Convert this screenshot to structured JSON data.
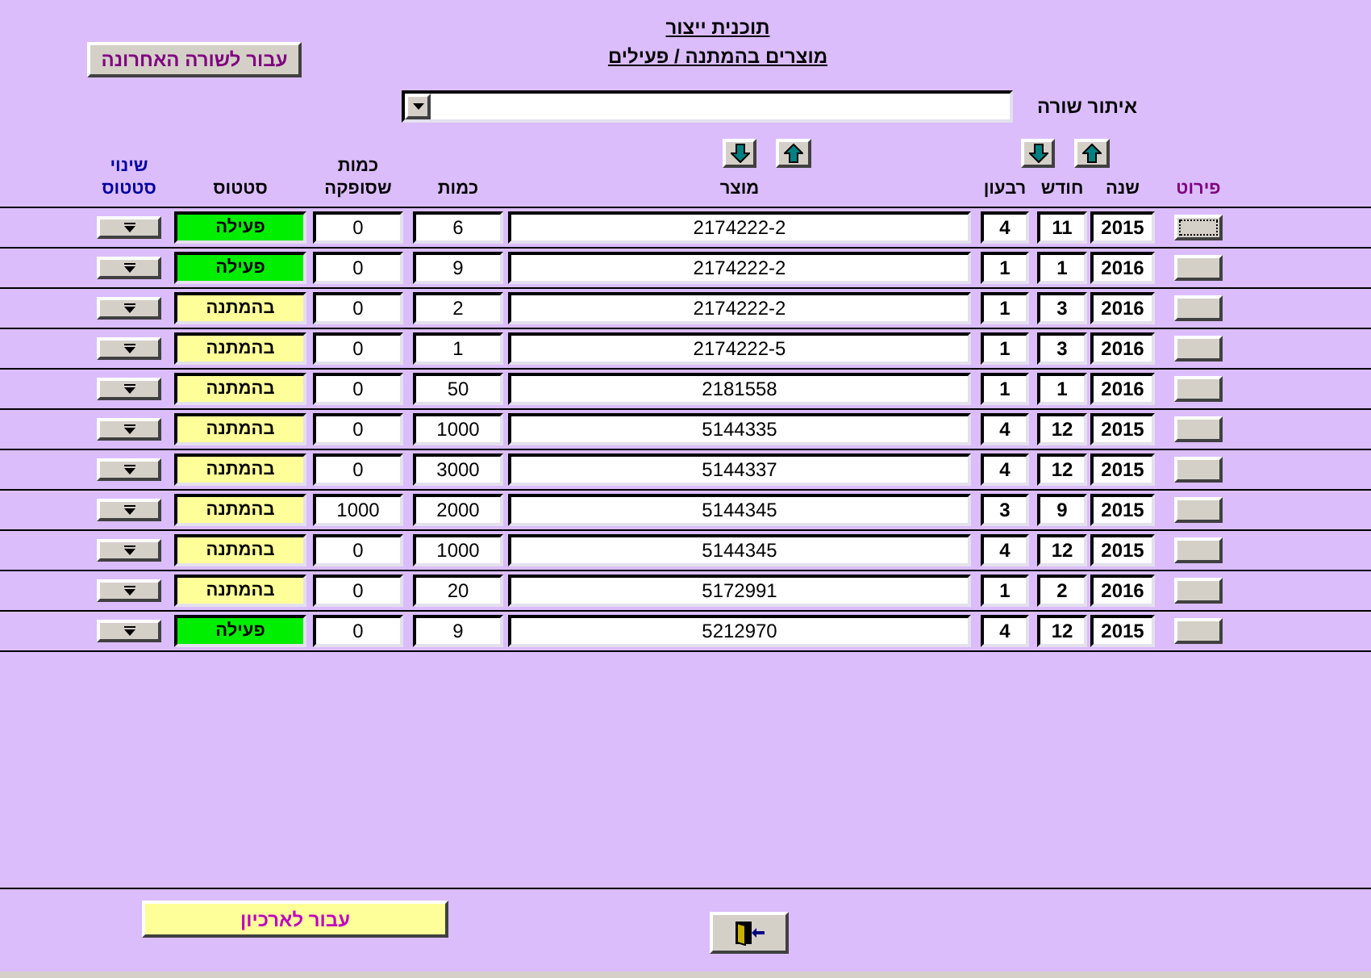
{
  "header": {
    "title": "תוכנית ייצור",
    "subtitle": "מוצרים בהמתנה / פעילים"
  },
  "go_to_last_button": {
    "label": "עבור לשורה האחרונה"
  },
  "find_row": {
    "label": "איתור שורה"
  },
  "table": {
    "columns": [
      {
        "label": "פירוט",
        "color": "#800080"
      },
      {
        "label": "שנה",
        "color": "#000000"
      },
      {
        "label": "חודש",
        "color": "#000000"
      },
      {
        "label": "רבעון",
        "color": "#000000"
      },
      {
        "label": "מוצר",
        "color": "#000000"
      },
      {
        "label": "כמות",
        "color": "#000000"
      },
      {
        "label": "כמות שסופקה",
        "color": "#000000"
      },
      {
        "label": "סטטוס",
        "color": "#000000"
      },
      {
        "label": "שינוי סטטוס",
        "color": "#0000a0"
      }
    ],
    "rows": [
      {
        "year": "2015",
        "month": "11",
        "quarter": "4",
        "product": "2174222-2",
        "quantity": "6",
        "supplied": "0",
        "status": "פעילה",
        "color": "#00ee00",
        "details_focused": true
      },
      {
        "year": "2016",
        "month": "1",
        "quarter": "1",
        "product": "2174222-2",
        "quantity": "9",
        "supplied": "0",
        "status": "פעילה",
        "color": "#00ee00",
        "details_focused": false
      },
      {
        "year": "2016",
        "month": "3",
        "quarter": "1",
        "product": "2174222-2",
        "quantity": "2",
        "supplied": "0",
        "status": "בהמתנה",
        "color": "#ffff99",
        "details_focused": false
      },
      {
        "year": "2016",
        "month": "3",
        "quarter": "1",
        "product": "2174222-5",
        "quantity": "1",
        "supplied": "0",
        "status": "בהמתנה",
        "color": "#ffff99",
        "details_focused": false
      },
      {
        "year": "2016",
        "month": "1",
        "quarter": "1",
        "product": "2181558",
        "quantity": "50",
        "supplied": "0",
        "status": "בהמתנה",
        "color": "#ffff99",
        "details_focused": false
      },
      {
        "year": "2015",
        "month": "12",
        "quarter": "4",
        "product": "5144335",
        "quantity": "1000",
        "supplied": "0",
        "status": "בהמתנה",
        "color": "#ffff99",
        "details_focused": false
      },
      {
        "year": "2015",
        "month": "12",
        "quarter": "4",
        "product": "5144337",
        "quantity": "3000",
        "supplied": "0",
        "status": "בהמתנה",
        "color": "#ffff99",
        "details_focused": false
      },
      {
        "year": "2015",
        "month": "9",
        "quarter": "3",
        "product": "5144345",
        "quantity": "2000",
        "supplied": "1000",
        "status": "בהמתנה",
        "color": "#ffff99",
        "details_focused": false
      },
      {
        "year": "2015",
        "month": "12",
        "quarter": "4",
        "product": "5144345",
        "quantity": "1000",
        "supplied": "0",
        "status": "בהמתנה",
        "color": "#ffff99",
        "details_focused": false
      },
      {
        "year": "2016",
        "month": "2",
        "quarter": "1",
        "product": "5172991",
        "quantity": "20",
        "supplied": "0",
        "status": "בהמתנה",
        "color": "#ffff99",
        "details_focused": false
      },
      {
        "year": "2015",
        "month": "12",
        "quarter": "4",
        "product": "5212970",
        "quantity": "9",
        "supplied": "0",
        "status": "פעילה",
        "color": "#00ee00",
        "details_focused": false
      }
    ]
  },
  "archive_button": {
    "label": "עבור לארכיון"
  }
}
